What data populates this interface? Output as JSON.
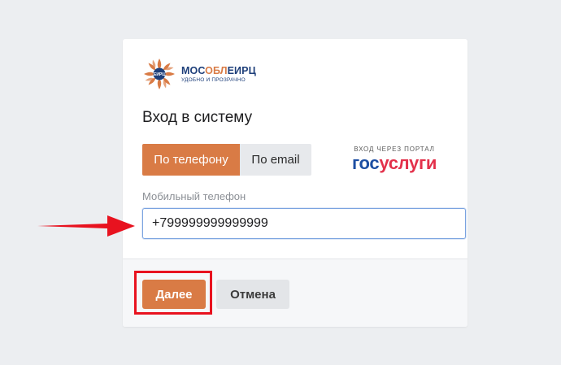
{
  "logo": {
    "name_part1": "МОС",
    "name_part2": "ОБЛ",
    "name_part3": "ЕИРЦ",
    "tagline": "УДОБНО И ПРОЗРАЧНО",
    "badge": "ЕИРЦ"
  },
  "login": {
    "title": "Вход в систему",
    "tabs": [
      {
        "label": "По телефону",
        "active": true
      },
      {
        "label": "По email",
        "active": false
      }
    ]
  },
  "gosuslugi": {
    "caption": "ВХОД ЧЕРЕЗ ПОРТАЛ",
    "logo_part1": "гос",
    "logo_part2": "услуги"
  },
  "phone_field": {
    "label": "Мобильный телефон",
    "value": "+799999999999999"
  },
  "footer": {
    "next_label": "Далее",
    "cancel_label": "Отмена"
  },
  "colors": {
    "accent": "#d97b45",
    "brand_blue": "#1e3f7a",
    "annotation_red": "#e8121f"
  }
}
